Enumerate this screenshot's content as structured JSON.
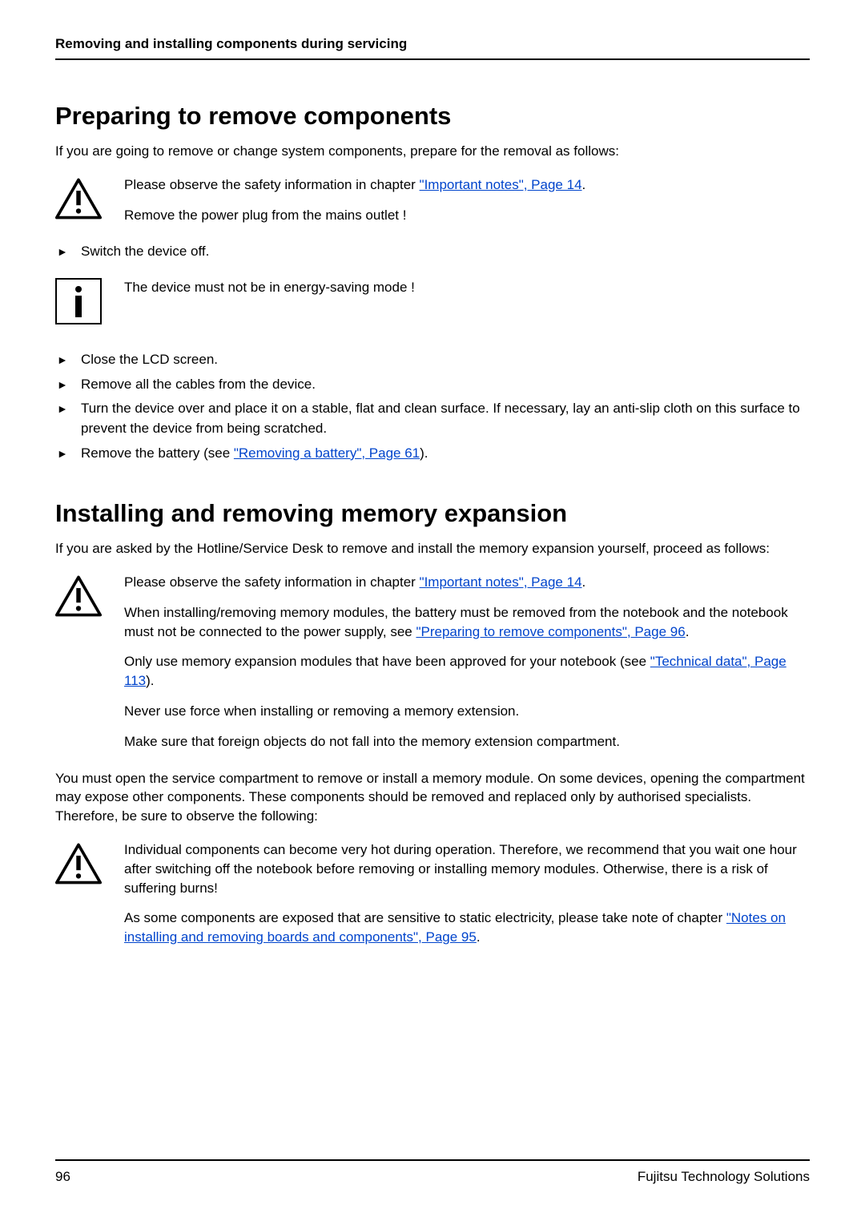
{
  "header": {
    "title": "Removing and installing components during servicing"
  },
  "section1": {
    "heading": "Preparing to remove components",
    "intro": "If you are going to remove or change system components, prepare for the removal as follows:",
    "warn1_part1": "Please observe the safety information in chapter ",
    "warn1_link": "\"Important notes\", Page 14",
    "warn1_part2": ".",
    "warn1_line2": "Remove the power plug from the mains outlet !",
    "step1": "Switch the device off.",
    "info1": "The device must not be in energy-saving mode !",
    "step2": "Close the LCD screen.",
    "step3": "Remove all the cables from the device.",
    "step4": "Turn the device over and place it on a stable, flat and clean surface. If necessary, lay an anti-slip cloth on this surface to prevent the device from being scratched.",
    "step5_part1": "Remove the battery (see ",
    "step5_link": "\"Removing a battery\", Page 61",
    "step5_part2": ")."
  },
  "section2": {
    "heading": "Installing and removing memory expansion",
    "intro": "If you are asked by the Hotline/Service Desk to remove and install the memory expansion yourself, proceed as follows:",
    "warn2_p1_a": "Please observe the safety information in chapter ",
    "warn2_p1_link": "\"Important notes\", Page 14",
    "warn2_p1_b": ".",
    "warn2_p2_a": "When installing/removing memory modules, the battery must be removed from the notebook and the notebook must not be connected to the power supply, see ",
    "warn2_p2_link": "\"Preparing to remove components\", Page 96",
    "warn2_p2_b": ".",
    "warn2_p3_a": "Only use memory expansion modules that have been approved for your notebook (see ",
    "warn2_p3_link": "\"Technical data\", Page 113",
    "warn2_p3_b": ").",
    "warn2_p4": "Never use force when installing or removing a memory extension.",
    "warn2_p5": "Make sure that foreign objects do not fall into the memory extension compartment.",
    "midpara": "You must open the service compartment to remove or install a memory module. On some devices, opening the compartment may expose other components. These components should be removed and replaced only by authorised specialists. Therefore, be sure to observe the following:",
    "warn3_p1": "Individual components can become very hot during operation. Therefore, we recommend that you wait one hour after switching off the notebook before removing or installing memory modules. Otherwise, there is a risk of suffering burns!",
    "warn3_p2_a": "As some components are exposed that are sensitive to static electricity, please take note of chapter ",
    "warn3_p2_link": "\"Notes on installing and removing boards and components\", Page 95",
    "warn3_p2_b": "."
  },
  "footer": {
    "page": "96",
    "company": "Fujitsu Technology Solutions"
  }
}
